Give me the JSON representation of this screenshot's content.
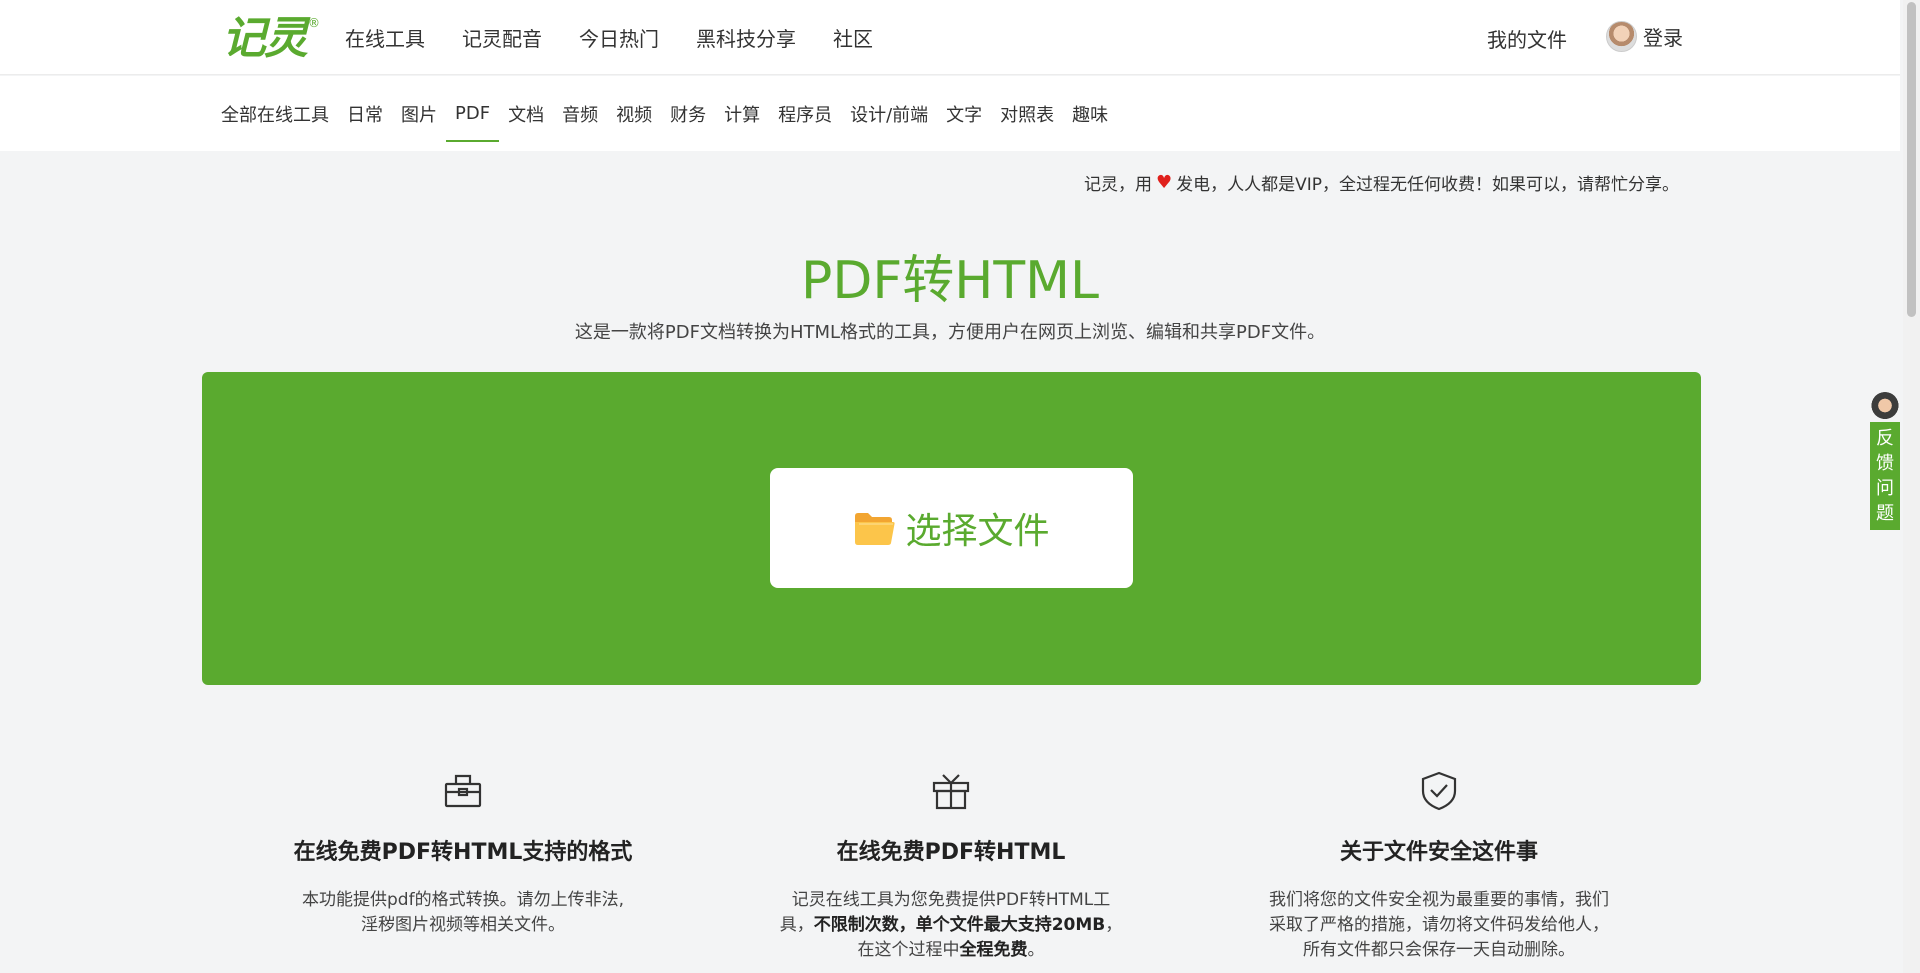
{
  "brand": {
    "logo_text": "记灵",
    "reg_mark": "®"
  },
  "top_nav": [
    "在线工具",
    "记灵配音",
    "今日热门",
    "黑科技分享",
    "社区"
  ],
  "header_right": {
    "my_files": "我的文件",
    "login": "登录"
  },
  "sub_nav": {
    "items": [
      "全部在线工具",
      "日常",
      "图片",
      "PDF",
      "文档",
      "音频",
      "视频",
      "财务",
      "计算",
      "程序员",
      "设计/前端",
      "文字",
      "对照表",
      "趣味"
    ],
    "active": "PDF"
  },
  "notice": {
    "before": "记灵，用",
    "after": "发电，人人都是VIP，全过程无任何收费！如果可以，请帮忙分享。"
  },
  "page": {
    "title": "PDF转HTML",
    "subtitle": "这是一款将PDF文档转换为HTML格式的工具，方便用户在网页上浏览、编辑和共享PDF文件。"
  },
  "upload": {
    "button_label": "选择文件",
    "icon": "folder-icon"
  },
  "features": [
    {
      "icon": "toolbox-icon",
      "title": "在线免费PDF转HTML支持的格式",
      "lines": [
        "本功能提供pdf的格式转换。请勿上传非法,",
        "淫秽图片视频等相关文件。"
      ]
    },
    {
      "icon": "gift-icon",
      "title": "在线免费PDF转HTML",
      "line1": "记灵在线工具为您免费提供PDF转HTML工",
      "line2_a": "具，",
      "line2_b": "不限制次数，单个文件最大支持20MB",
      "line2_c": "，",
      "line3_a": "在这个过程中",
      "line3_b": "全程免费",
      "line3_c": "。"
    },
    {
      "icon": "shield-check-icon",
      "title": "关于文件安全这件事",
      "lines": [
        "我们将您的文件安全视为最重要的事情，我们",
        "采取了严格的措施，请勿将文件码发给他人，",
        "所有文件都只会保存一天自动删除。"
      ]
    }
  ],
  "feedback": {
    "chars": [
      "反",
      "馈",
      "问",
      "题"
    ]
  },
  "colors": {
    "brand_green": "#5aaa2f",
    "heart_red": "#e0201c",
    "page_bg": "#f3f4f5"
  }
}
